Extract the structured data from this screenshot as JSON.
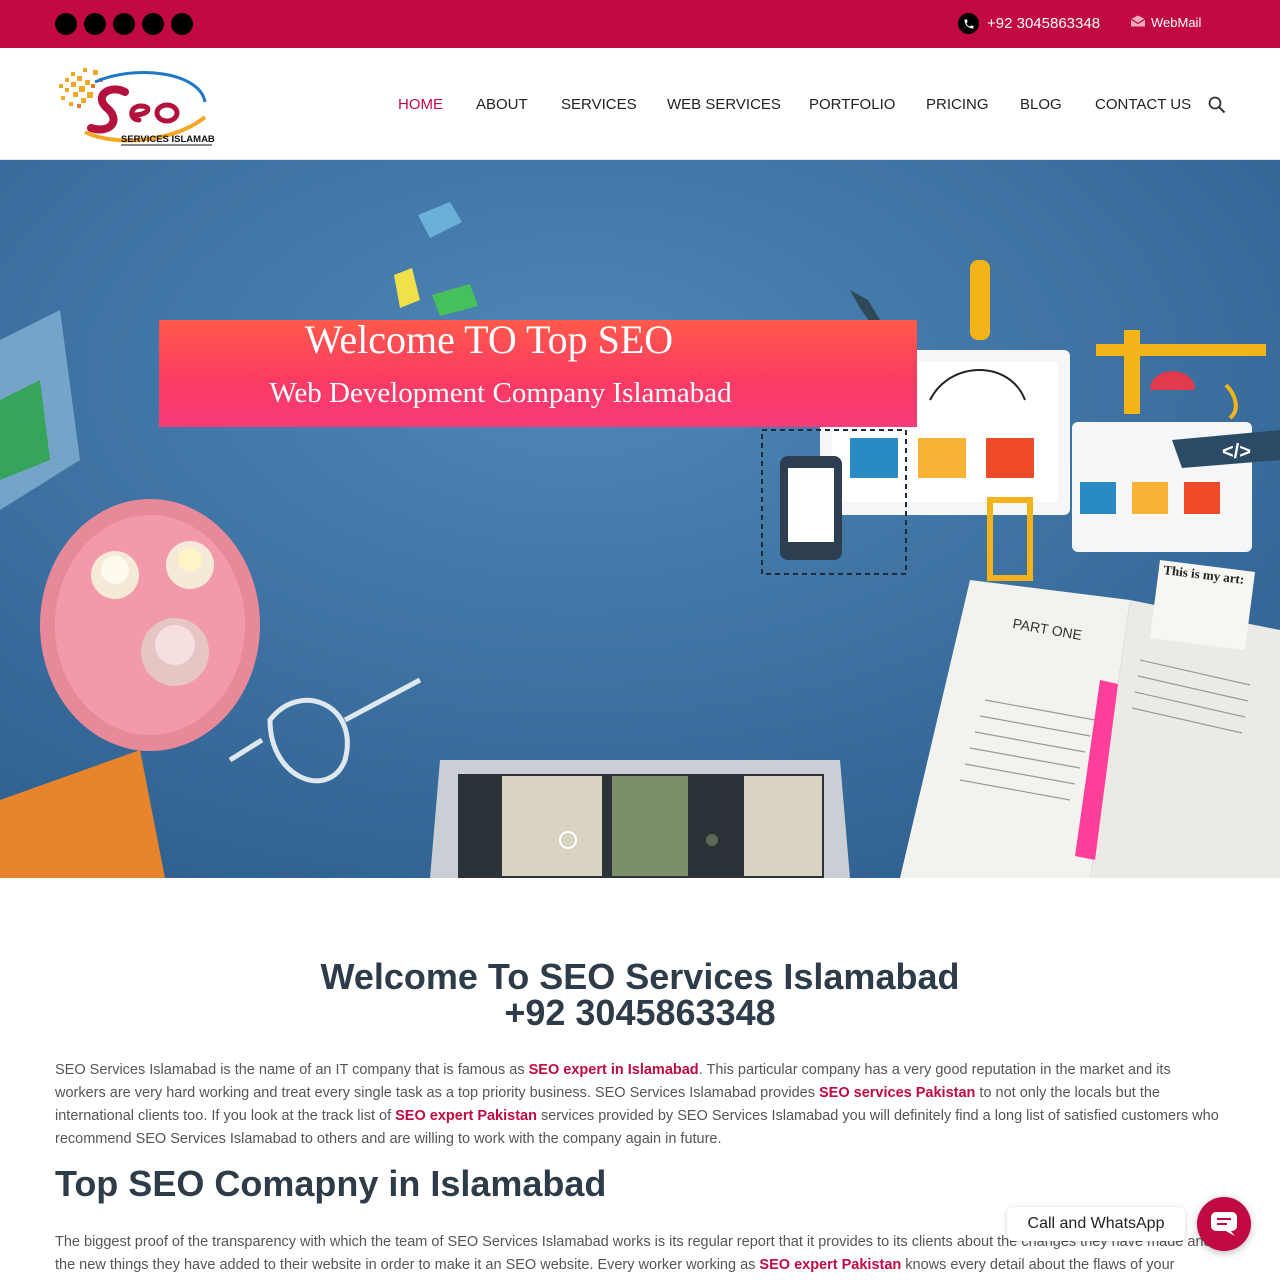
{
  "topbar": {
    "social_links": [
      "social-link-1",
      "social-link-2",
      "social-link-3",
      "social-link-4",
      "social-link-5"
    ],
    "phone": "+92 3045863348",
    "webmail_label": "WebMail",
    "background_color": "#c00a41"
  },
  "header": {
    "logo": {
      "word": "Seo",
      "tagline": "SERVICES ISLAMABAD"
    },
    "nav": [
      {
        "label": "HOME",
        "active": true
      },
      {
        "label": "ABOUT"
      },
      {
        "label": "SERVICES"
      },
      {
        "label": "WEB SERVICES"
      },
      {
        "label": "PORTFOLIO"
      },
      {
        "label": "PRICING"
      },
      {
        "label": "BLOG"
      },
      {
        "label": "CONTACT US"
      }
    ],
    "search_icon": "search-icon",
    "accent_color": "#c00a41"
  },
  "hero": {
    "title": "Welcome TO Top SEO",
    "subtitle": "Web Development Company Islamabad",
    "book_heading": "PART ONE",
    "note_heading": "This is my art:",
    "code_tag": "</>",
    "banner_color": "#fb3b62"
  },
  "main": {
    "heading": "Welcome To SEO Services Islamabad",
    "phone": "+92 3045863348",
    "intro": {
      "t1": "SEO Services Islamabad is the name of an IT company that is famous as ",
      "l1": "SEO expert in Islamabad",
      "t2": ". This particular company has a very good reputation in the market and its workers are very hard working and treat every single task as a top priority business. SEO Services Islamabad provides ",
      "l2": "SEO services Pakistan",
      "t3": " to not only the locals but the international clients too. If you look at the track list of ",
      "l3": "SEO expert Pakistan",
      "t4": " services provided by SEO Services Islamabad  you will definitely find a long list of satisfied customers who recommend SEO Services Islamabad  to others and are willing to work with the company again in future."
    },
    "subheading": "Top SEO Comapny in Islamabad",
    "second": {
      "t1": "The biggest proof of the transparency with which the team of SEO Services Islamabad  works is its regular report that it provides to its clients about the changes they have made and the new things they have added to their website in order to make it an SEO website. Every worker working as ",
      "l1": "SEO expert Pakistan",
      "t2": " knows every detail about the flaws of your website and the"
    }
  },
  "chat": {
    "label": "Call and WhatsApp",
    "icon": "chat-bubble-icon"
  }
}
